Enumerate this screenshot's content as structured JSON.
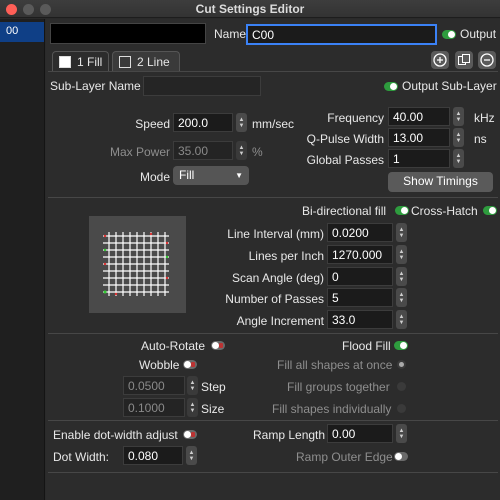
{
  "window": {
    "title": "Cut Settings Editor"
  },
  "colors": {
    "close": "#ff5f57",
    "minimize": "#5a5a5a",
    "maximize": "#5a5a5a",
    "selection": "#0f3f86",
    "toggle_on": "#2e9c3e"
  },
  "layers": [
    {
      "label": "00"
    }
  ],
  "header": {
    "name_label": "Name",
    "name_value": "C00",
    "output_label": "Output",
    "output_on": true
  },
  "tabs": [
    {
      "label": "1 Fill",
      "active": true
    },
    {
      "label": "2 Line",
      "active": false
    }
  ],
  "sublayer": {
    "name_label": "Sub-Layer Name",
    "name_value": "",
    "output_label": "Output Sub-Layer",
    "output_on": true
  },
  "laser": {
    "speed_label": "Speed",
    "speed_value": "200.0",
    "speed_unit": "mm/sec",
    "maxpower_label": "Max Power",
    "maxpower_value": "35.00",
    "maxpower_unit": "%",
    "mode_label": "Mode",
    "mode_value": "Fill",
    "frequency_label": "Frequency",
    "frequency_value": "40.00",
    "frequency_unit": "kHz",
    "qpulse_label": "Q-Pulse Width",
    "qpulse_value": "13.00",
    "qpulse_unit": "ns",
    "passes_label": "Global Passes",
    "passes_value": "1",
    "show_timings": "Show Timings"
  },
  "fill": {
    "bidir_label": "Bi-directional fill",
    "bidir_on": true,
    "crosshatch_label": "Cross-Hatch",
    "crosshatch_on": true,
    "interval_label": "Line Interval (mm)",
    "interval_value": "0.0200",
    "lpi_label": "Lines per Inch",
    "lpi_value": "1270.000",
    "angle_label": "Scan Angle (deg)",
    "angle_value": "0",
    "numpasses_label": "Number of Passes",
    "numpasses_value": "5",
    "angleinc_label": "Angle Increment",
    "angleinc_value": "33.0"
  },
  "options": {
    "autorotate_label": "Auto-Rotate",
    "wobble_label": "Wobble",
    "step_value": "0.0500",
    "step_label": "Step",
    "size_value": "0.1000",
    "size_label": "Size",
    "floodfill_label": "Flood Fill",
    "floodfill_on": true,
    "fill_all": "Fill all shapes at once",
    "fill_groups": "Fill groups together",
    "fill_indiv": "Fill shapes individually"
  },
  "dot": {
    "enable_label": "Enable dot-width adjust",
    "dotwidth_label": "Dot Width:",
    "dotwidth_value": "0.080",
    "ramp_label": "Ramp Length",
    "ramp_value": "0.00",
    "rampouter_label": "Ramp Outer Edge"
  }
}
